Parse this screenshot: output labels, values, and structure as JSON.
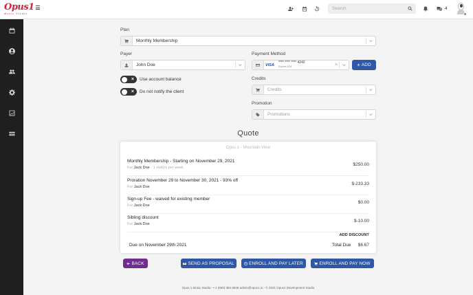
{
  "header": {
    "logo_text": "Opus1",
    "logo_sub": "Music Studio",
    "search_placeholder": "Search",
    "message_count": "4",
    "icons": [
      "add-user-icon",
      "calendar-icon",
      "history-icon",
      "bell-icon",
      "chat-icon"
    ]
  },
  "sidebar": {
    "items": [
      {
        "icon": "calendar-icon"
      },
      {
        "icon": "user-circle-icon"
      },
      {
        "icon": "users-icon"
      },
      {
        "icon": "gear-icon"
      },
      {
        "icon": "chart-icon"
      },
      {
        "icon": "grid-icon"
      }
    ]
  },
  "form": {
    "plan_label": "Plan",
    "plan_value": "Monthly Membership",
    "payer_label": "Payer",
    "payer_value": "John Doe",
    "use_balance_label": "Use account balance",
    "no_notify_label": "Do not notify the client",
    "payment_label": "Payment Method",
    "card_brand": "VISA",
    "card_number": "**** **** **** 4242",
    "card_expiry": "Expires 4/24",
    "add_label": "ADD",
    "credits_label": "Credits",
    "credits_placeholder": "Credits",
    "promotion_label": "Promotion",
    "promotion_placeholder": "Promotions"
  },
  "quote": {
    "title": "Quote",
    "location": "Opus 1 - Mountain View",
    "lines": [
      {
        "desc": "Monthly Membership - Starting on November 29, 2021",
        "for_label": "For",
        "for_name": "Jack Doe",
        "extra": " - 1 visit(s) per week",
        "amount": "$250.00"
      },
      {
        "desc": "Proration November 29 to November 30, 2021 - 93% off",
        "for_label": "For",
        "for_name": "Jack Doe",
        "extra": "",
        "amount": "$-233.33"
      },
      {
        "desc": "Sign-up Fee - waived for existing member",
        "for_label": "For",
        "for_name": "Jack Doe",
        "extra": "",
        "amount": "$0.00"
      },
      {
        "desc": "Sibling discount",
        "for_label": "For",
        "for_name": "Jack Doe",
        "extra": "",
        "amount": "$-10.00"
      }
    ],
    "add_discount": "ADD DISCOUNT",
    "due_text": "Due on November 29th 2021",
    "total_label": "Total Due",
    "total_value": "$6.67"
  },
  "actions": {
    "back": "BACK",
    "send_proposal": "SEND AS PROPOSAL",
    "enroll_later": "ENROLL AND PAY LATER",
    "enroll_now": "ENROLL AND PAY NOW"
  },
  "footer": "Opus 1 Music Studio - • 1 (650) 384 6848 admin@opus1.io - © 2021 Opus1 Development Studio",
  "colors": {
    "brand_red": "#d0243b",
    "primary_blue": "#2e57a5",
    "back_purple": "#6f2d91",
    "sidebar_bg": "#1f1f1f"
  }
}
